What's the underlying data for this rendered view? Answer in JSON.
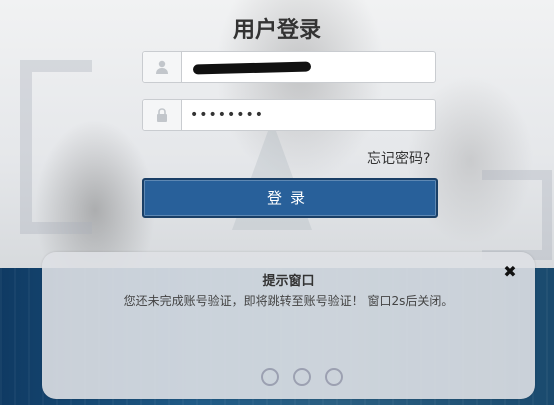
{
  "login": {
    "title": "用户登录",
    "username_value": "",
    "password_value": "••••••••",
    "forgot_label": "忘记密码?",
    "submit_label": "登录"
  },
  "modal": {
    "title": "提示窗口",
    "message": "您还未完成账号验证，即将跳转至账号验证！ 窗口2s后关闭。",
    "close_glyph": "✖"
  },
  "icons": {
    "username": "user-icon",
    "password": "lock-icon"
  },
  "colors": {
    "primary_button": "#28609a",
    "modal_bg": "#dedfe4"
  }
}
